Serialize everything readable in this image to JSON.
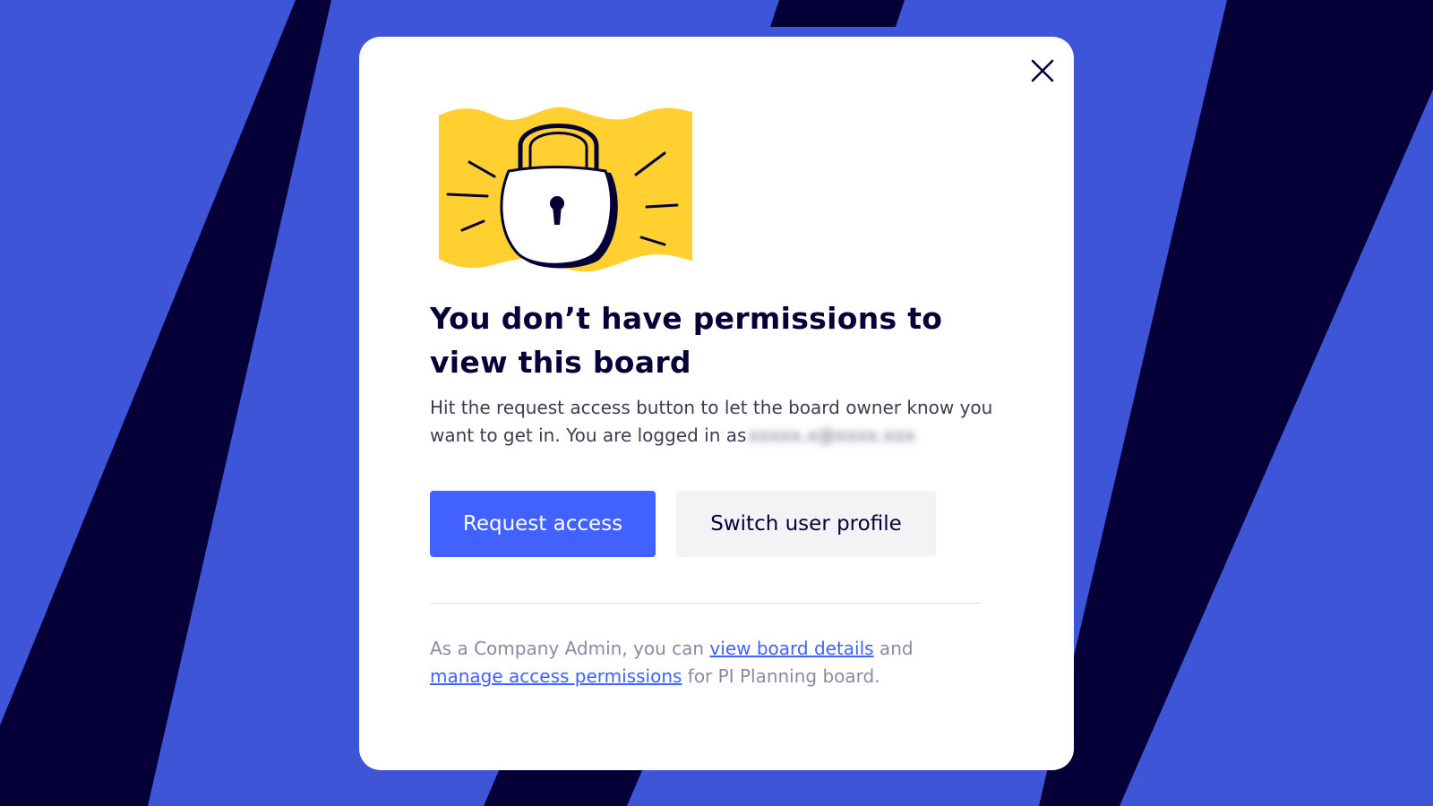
{
  "colors": {
    "background_blue": "#3f55d8",
    "background_navy": "#050038",
    "accent_yellow": "#ffd02f",
    "primary_button": "#4262ff",
    "link": "#4262ff"
  },
  "dialog": {
    "close_icon": "close-icon",
    "illustration_icon": "padlock-icon",
    "title": "You don’t have permissions to view this board",
    "description": "Hit the request access button to let the board owner know you want to get in. You are logged in as",
    "blurred_email": "xxxxx.x@xxxx.xxx",
    "request_access_label": "Request access",
    "switch_profile_label": "Switch user profile",
    "admin_note": {
      "prefix": "As a Company Admin, you can ",
      "link_details": "view board details",
      "middle": " and ",
      "link_permissions": "manage access permissions",
      "suffix": " for PI Planning board."
    }
  }
}
